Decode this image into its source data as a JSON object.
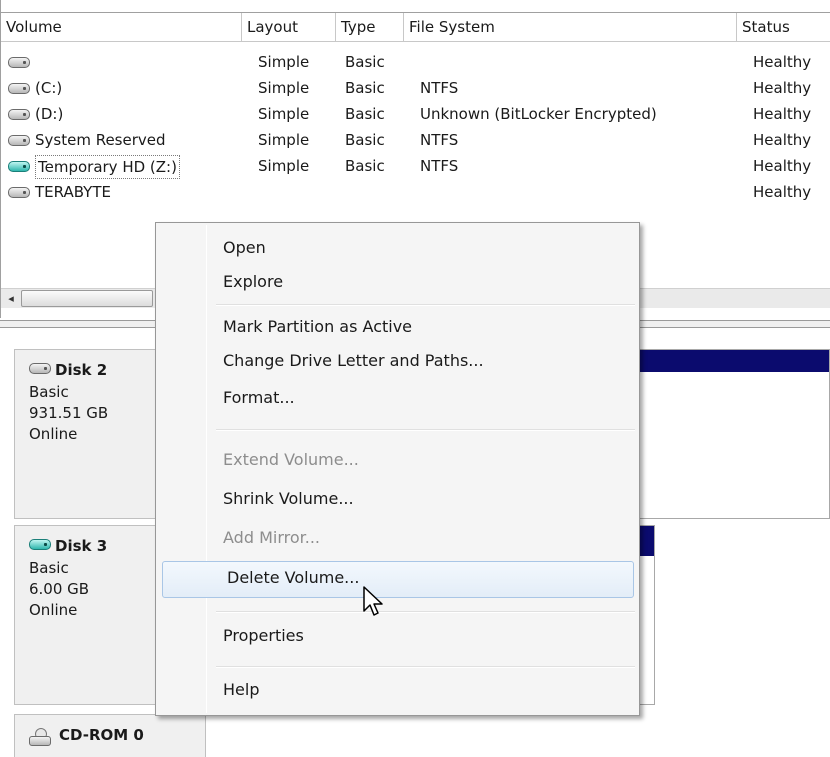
{
  "columns": {
    "volume": "Volume",
    "layout": "Layout",
    "type": "Type",
    "file_system": "File System",
    "status": "Status"
  },
  "volumes": [
    {
      "name": "",
      "layout": "Simple",
      "type": "Basic",
      "fs": "",
      "status": "Healthy",
      "icon": "drive-icon"
    },
    {
      "name": "(C:)",
      "layout": "Simple",
      "type": "Basic",
      "fs": "NTFS",
      "status": "Healthy",
      "icon": "drive-icon"
    },
    {
      "name": "(D:)",
      "layout": "Simple",
      "type": "Basic",
      "fs": "Unknown (BitLocker Encrypted)",
      "status": "Healthy",
      "icon": "drive-icon"
    },
    {
      "name": "System Reserved",
      "layout": "Simple",
      "type": "Basic",
      "fs": "NTFS",
      "status": "Healthy",
      "icon": "drive-icon"
    },
    {
      "name": "Temporary HD (Z:)",
      "layout": "Simple",
      "type": "Basic",
      "fs": "NTFS",
      "status": "Healthy",
      "icon": "drive-icon-green"
    },
    {
      "name": "TERABYTE",
      "layout": "",
      "type": "",
      "fs": "",
      "status": "Healthy",
      "icon": "drive-icon"
    }
  ],
  "scrollbar": {
    "left_arrow": "◂"
  },
  "disks": [
    {
      "name": "Disk 2",
      "kind": "Basic",
      "size": "931.51 GB",
      "state": "Online",
      "icon": "drive-icon"
    },
    {
      "name": "Disk 3",
      "kind": "Basic",
      "size": "6.00 GB",
      "state": "Online",
      "icon": "drive-icon-green"
    },
    {
      "name": "CD-ROM 0",
      "icon": "cdrom-icon"
    }
  ],
  "context_menu": {
    "items": [
      {
        "label": "Open",
        "enabled": true
      },
      {
        "label": "Explore",
        "enabled": true
      },
      {
        "label": "Mark Partition as Active",
        "enabled": true
      },
      {
        "label": "Change Drive Letter and Paths...",
        "enabled": true
      },
      {
        "label": "Format...",
        "enabled": true
      },
      {
        "label": "Extend Volume...",
        "enabled": false
      },
      {
        "label": "Shrink Volume...",
        "enabled": true
      },
      {
        "label": "Add Mirror...",
        "enabled": false
      },
      {
        "label": "Delete Volume...",
        "enabled": true,
        "hovered": true
      },
      {
        "label": "Properties",
        "enabled": true
      },
      {
        "label": "Help",
        "enabled": true
      }
    ]
  },
  "colors": {
    "volume_bar": "#0b0b6e",
    "menu_hover_border": "#a9c6e6",
    "disabled_text": "#8d8d8d"
  }
}
